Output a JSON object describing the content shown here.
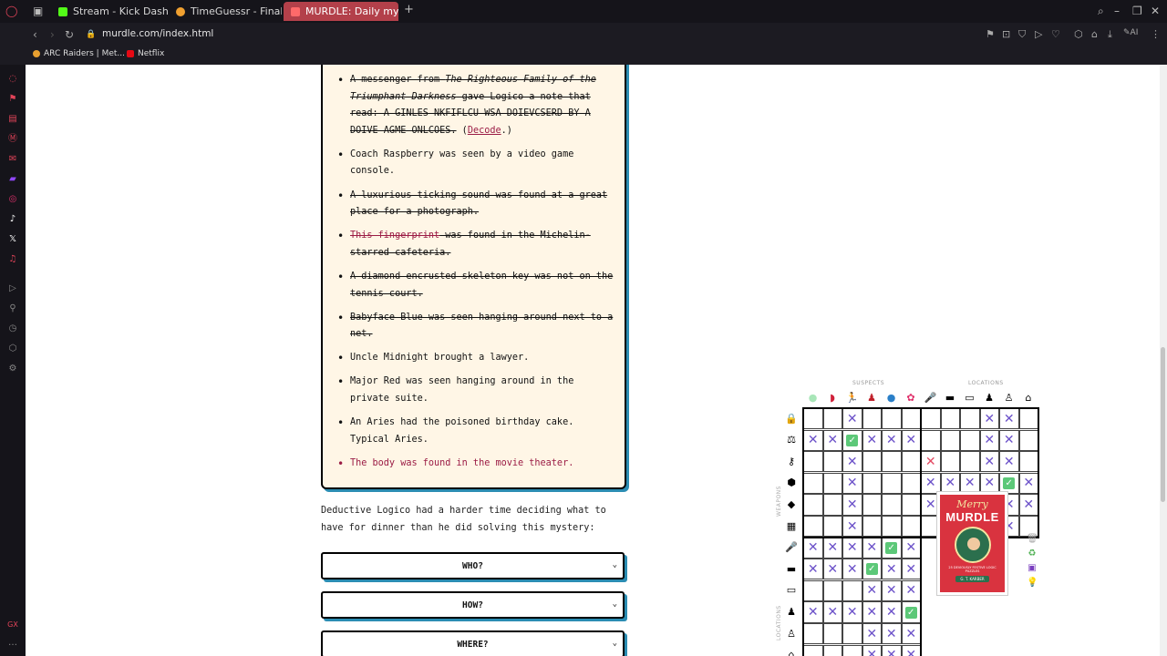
{
  "tabs": [
    {
      "label": "Stream - Kick Dashboard",
      "fav_color": "#53fc18"
    },
    {
      "label": "TimeGuessr - Final Score",
      "fav_color": "#f0a030"
    },
    {
      "label": "MURDLE: Daily mystery pu",
      "fav_color": "#d33"
    }
  ],
  "new_tab_icon": "plus-icon",
  "address": {
    "url": "murdle.com/index.html"
  },
  "bookmarks": [
    {
      "label": "ARC Raiders | Met...",
      "color": "#e8a030"
    },
    {
      "label": "Netflix",
      "color": "#e50914"
    }
  ],
  "clues": [
    {
      "parts": [
        {
          "t": "A messenger from ",
          "s": "txt"
        },
        {
          "t": "The Righteous Family of the Triumphant Darkness",
          "s": "txt ital"
        },
        {
          "t": " gave Logico a note that read: A GINLES NKFIFLCU WSA DOIEVCSERD BY A DOIVE AGME ONLCOES.",
          "s": "txt"
        },
        {
          "t": " (",
          "s": ""
        },
        {
          "t": "Decode",
          "s": "decode"
        },
        {
          "t": ".)",
          "s": ""
        }
      ],
      "cls": "struck"
    },
    {
      "parts": [
        {
          "t": "Coach Raspberry was seen by a video game console.",
          "s": ""
        }
      ],
      "cls": ""
    },
    {
      "parts": [
        {
          "t": "A luxurious ticking sound was found at a great place for a photograph.",
          "s": "txt"
        }
      ],
      "cls": "struck"
    },
    {
      "parts": [
        {
          "t": "This fingerprint",
          "s": "mistake"
        },
        {
          "t": " was found in the Michelin-starred cafeteria.",
          "s": "txt"
        }
      ],
      "cls": "struck"
    },
    {
      "parts": [
        {
          "t": "A diamond encrusted skeleton key was not on the tennis court.",
          "s": "txt"
        }
      ],
      "cls": "struck"
    },
    {
      "parts": [
        {
          "t": "Babyface Blue was seen hanging around next to a net.",
          "s": "txt"
        }
      ],
      "cls": "struck"
    },
    {
      "parts": [
        {
          "t": "Uncle Midnight brought a lawyer.",
          "s": ""
        }
      ],
      "cls": ""
    },
    {
      "parts": [
        {
          "t": "Major Red was seen hanging around in the private suite.",
          "s": ""
        }
      ],
      "cls": ""
    },
    {
      "parts": [
        {
          "t": "An Aries had the poisoned birthday cake. Typical Aries.",
          "s": ""
        }
      ],
      "cls": ""
    },
    {
      "parts": [
        {
          "t": "The body was found in the movie theater.",
          "s": ""
        }
      ],
      "cls": "red"
    }
  ],
  "dinner_text": "Deductive Logico had a harder time deciding what to have for dinner than he did solving this mystery:",
  "questions": [
    "WHO?",
    "HOW?",
    "WHERE?"
  ],
  "grid": {
    "suspects_label": "SUSPECTS",
    "locations_label": "LOCATIONS",
    "weapons_label": "WEAPONS",
    "locations_row_label": "LOCATIONS",
    "top_icons": [
      {
        "icon": "green-circle-icon",
        "glyph": "●",
        "color": "#a8e6b8"
      },
      {
        "icon": "red-helmet-icon",
        "glyph": "◗",
        "color": "#d0213a"
      },
      {
        "icon": "running-man-icon",
        "glyph": "🏃",
        "color": "#000"
      },
      {
        "icon": "red-figure-icon",
        "glyph": "♟",
        "color": "#c0202a"
      },
      {
        "icon": "blue-circle-icon",
        "glyph": "●",
        "color": "#2a7fc8"
      },
      {
        "icon": "pink-figure-icon",
        "glyph": "✿",
        "color": "#e0306a"
      },
      {
        "icon": "microphone-icon",
        "glyph": "🎤",
        "color": "#000"
      },
      {
        "icon": "cinema-icon",
        "glyph": "▬",
        "color": "#000"
      },
      {
        "icon": "sofa-icon",
        "glyph": "▭",
        "color": "#000"
      },
      {
        "icon": "chess-pawn-icon",
        "glyph": "♟",
        "color": "#000"
      },
      {
        "icon": "person-icon",
        "glyph": "♙",
        "color": "#000"
      },
      {
        "icon": "house-icon",
        "glyph": "⌂",
        "color": "#000"
      }
    ],
    "left_icons": [
      {
        "icon": "lock-icon",
        "glyph": "🔒"
      },
      {
        "icon": "scales-icon",
        "glyph": "⚖"
      },
      {
        "icon": "key-icon",
        "glyph": "⚷"
      },
      {
        "icon": "cake-icon",
        "glyph": "⬢"
      },
      {
        "icon": "diamond-icon",
        "glyph": "◆"
      },
      {
        "icon": "briefcase-icon",
        "glyph": "▦"
      },
      {
        "icon": "microphone-icon",
        "glyph": "🎤"
      },
      {
        "icon": "cinema-icon",
        "glyph": "▬"
      },
      {
        "icon": "sofa-icon",
        "glyph": "▭"
      },
      {
        "icon": "chess-pawn-icon",
        "glyph": "♟"
      },
      {
        "icon": "person-icon",
        "glyph": "♙"
      },
      {
        "icon": "house-icon",
        "glyph": "⌂"
      }
    ],
    "top_block": [
      [
        "",
        "",
        "x",
        "",
        "",
        "",
        "",
        "",
        "",
        "x",
        "x",
        ""
      ],
      [
        "x",
        "x",
        "c",
        "x",
        "x",
        "x",
        "",
        "",
        "",
        "x",
        "x",
        ""
      ],
      [
        "",
        "",
        "x",
        "",
        "",
        "",
        "rx",
        "",
        "",
        "x",
        "x",
        ""
      ],
      [
        "",
        "",
        "x",
        "",
        "",
        "",
        "x",
        "x",
        "x",
        "x",
        "c",
        "x"
      ],
      [
        "",
        "",
        "x",
        "",
        "",
        "",
        "x",
        "x",
        "x",
        "c",
        "x",
        "x"
      ],
      [
        "",
        "",
        "x",
        "",
        "",
        "",
        "",
        "",
        "",
        "x",
        "x",
        ""
      ]
    ],
    "bottom_block": [
      [
        "x",
        "x",
        "x",
        "x",
        "c",
        "x"
      ],
      [
        "x",
        "x",
        "x",
        "c",
        "x",
        "x"
      ],
      [
        "",
        "",
        "",
        "x",
        "x",
        "x"
      ],
      [
        "x",
        "x",
        "x",
        "x",
        "x",
        "c"
      ],
      [
        "",
        "",
        "",
        "x",
        "x",
        "x"
      ],
      [
        "",
        "",
        "",
        "x",
        "x",
        "x"
      ]
    ]
  },
  "book": {
    "title_1": "Merry",
    "title_2": "MURDLE",
    "subtitle": "25 DEVIOUSLY FESTIVE LOGIC PUZZLES",
    "author": "G. T. KARBER"
  },
  "side_tools": [
    {
      "icon": "trash-icon",
      "glyph": "🗑",
      "color": "#aaa"
    },
    {
      "icon": "recycle-icon",
      "glyph": "♻",
      "color": "#4caf50"
    },
    {
      "icon": "save-icon",
      "glyph": "▣",
      "color": "#7a3fbf"
    },
    {
      "icon": "lightbulb-icon",
      "glyph": "💡",
      "color": "#f0c020"
    }
  ]
}
